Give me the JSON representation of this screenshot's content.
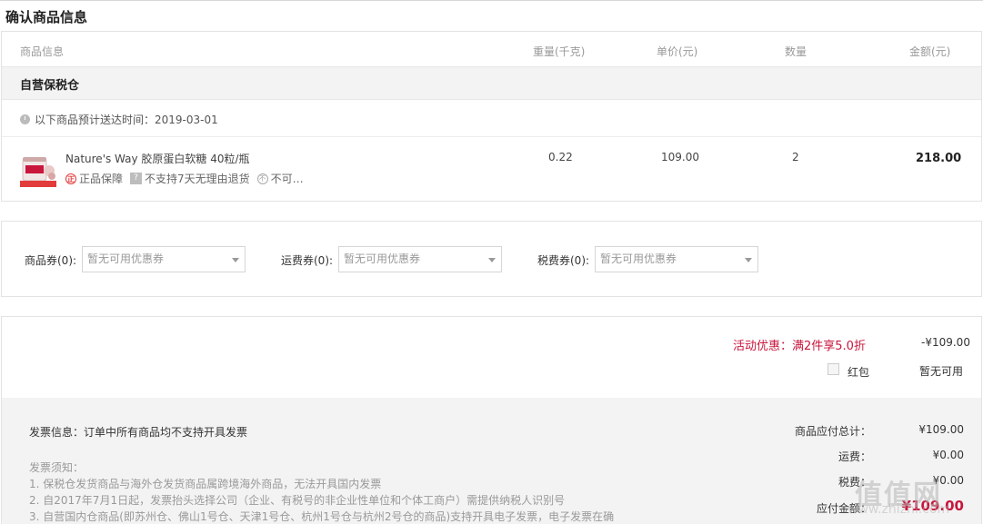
{
  "page_title": "确认商品信息",
  "columns": {
    "product": "商品信息",
    "weight": "重量(千克)",
    "unit_price": "单价(元)",
    "quantity": "数量",
    "amount": "金额(元)"
  },
  "warehouse": "自营保税仓",
  "delivery_text": "以下商品预计送达时间：2019-03-01",
  "item": {
    "name": "Nature's Way 胶原蛋白软糖 40粒/瓶",
    "tags": [
      "正品保障",
      "不支持7天无理由退货",
      "不可…"
    ],
    "weight": "0.22",
    "unit_price": "109.00",
    "quantity": "2",
    "amount": "218.00"
  },
  "coupons": [
    {
      "label": "商品券(0):",
      "placeholder": "暂无可用优惠券"
    },
    {
      "label": "运费券(0):",
      "placeholder": "暂无可用优惠券"
    },
    {
      "label": "税费券(0):",
      "placeholder": "暂无可用优惠券"
    }
  ],
  "promotion": {
    "label": "活动优惠：满2件享5.0折",
    "value": "-¥109.00"
  },
  "hongbao": {
    "label": "红包",
    "value": "暂无可用"
  },
  "invoice": {
    "info": "发票信息：订单中所有商品均不支持开具发票",
    "notes_title": "发票须知：",
    "notes": [
      "1. 保税仓发货商品与海外仓发货商品属跨境海外商品，无法开具国内发票",
      "2. 自2017年7月1日起，发票抬头选择公司（企业、有税号的非企业性单位和个体工商户）需提供纳税人识别号",
      "3. 自营国内仓商品(即苏州仓、佛山1号仓、天津1号仓、杭州1号仓与杭州2号仓的商品)支持开具电子发票，电子发票在确"
    ]
  },
  "summary": {
    "subtotal_label": "商品应付总计：",
    "subtotal_value": "¥109.00",
    "shipping_label": "运费：",
    "shipping_value": "¥0.00",
    "tax_label": "税费：",
    "tax_value": "¥0.00",
    "pay_label": "应付金额：",
    "pay_value": "¥109.00"
  },
  "watermark": {
    "main": "值值网",
    "sub": "www.zhizhi.com"
  },
  "colors": {
    "accent": "#c8163c",
    "panel": "#f3f3f3"
  }
}
